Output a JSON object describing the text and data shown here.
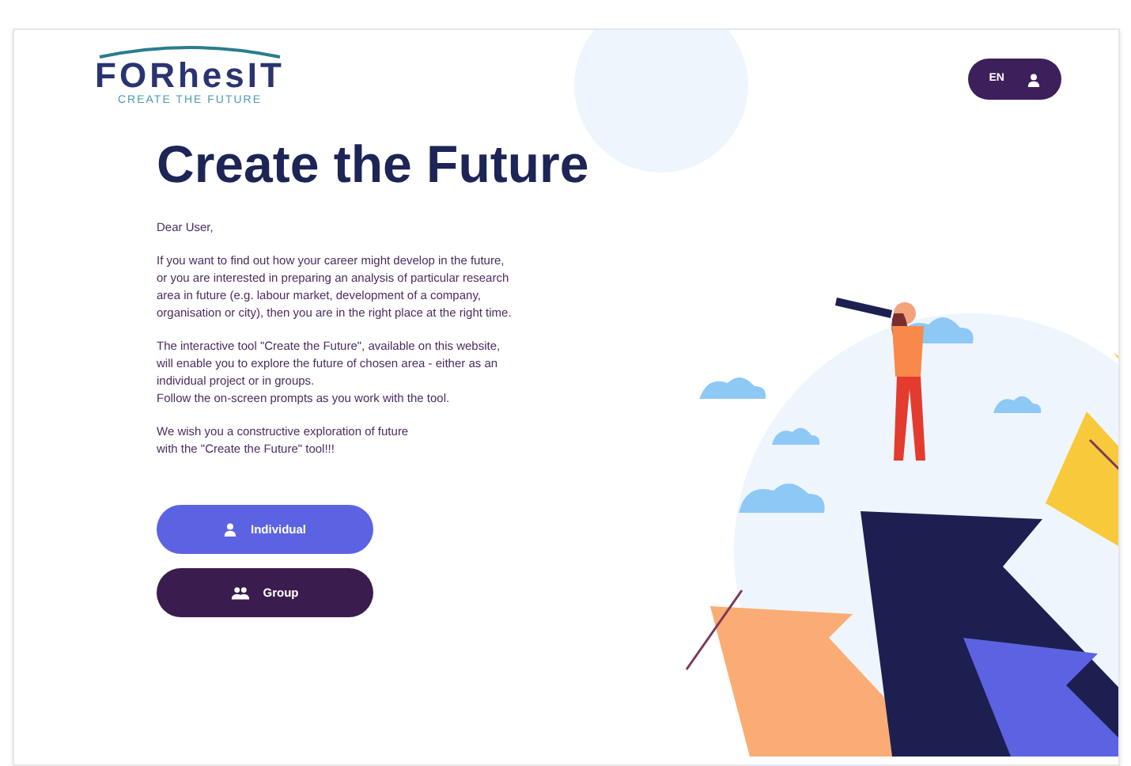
{
  "header": {
    "logo": {
      "name": "FORhesIT",
      "tagline": "CREATE THE FUTURE"
    },
    "language": "EN"
  },
  "title": "Create the Future",
  "paragraphs": [
    "Dear User,",
    "If you want to find out how your career might develop in the future,\nor you are interested in preparing an analysis of particular research\narea in future (e.g. labour market, development of a company,\norganisation or city), then you are in the right place at the right time.",
    "The interactive tool \"Create the Future\", available on this website,\nwill enable you to explore the future of chosen area - either as an\nindividual project or in groups.\nFollow the on-screen prompts as you work with the tool.",
    "We wish you a constructive exploration of future\nwith the \"Create the Future\" tool!!!"
  ],
  "buttons": [
    {
      "kind": "individual",
      "label": "Individual"
    },
    {
      "kind": "group",
      "label": "Group"
    }
  ]
}
